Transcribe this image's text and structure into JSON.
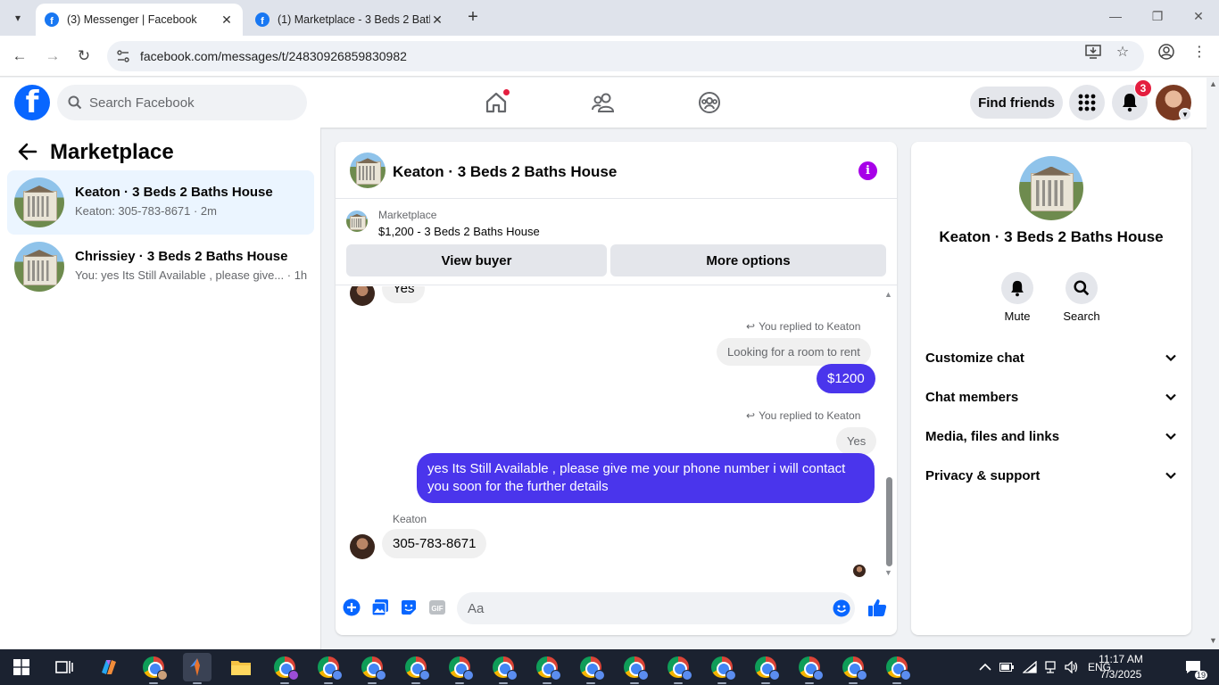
{
  "browser": {
    "tabs": [
      {
        "title": "(3) Messenger | Facebook",
        "active": true
      },
      {
        "title": "(1) Marketplace - 3 Beds 2 Bath",
        "active": false
      }
    ],
    "url": "facebook.com/messages/t/24830926859830982"
  },
  "fb": {
    "search_placeholder": "Search Facebook",
    "find_friends_label": "Find friends",
    "notification_count": "3"
  },
  "sidebar": {
    "title": "Marketplace",
    "conversations": [
      {
        "name": "Keaton · 3 Beds 2 Baths House",
        "preview": "Keaton: 305-783-8671 · 2m"
      },
      {
        "name": "Chrissiey · 3 Beds 2 Baths House",
        "preview": "You: yes Its Still Available , please give... · 1h"
      }
    ]
  },
  "chat": {
    "title": "Keaton · 3 Beds 2 Baths House",
    "listing_source": "Marketplace",
    "listing_title": "$1,200 - 3 Beds 2 Baths House",
    "view_buyer_label": "View buyer",
    "more_options_label": "More options",
    "messages": {
      "in_yes": "Yes",
      "replied_label_1": "You replied to Keaton",
      "reply_quote_1": "Looking for a room to rent",
      "out_price": "$1200",
      "replied_label_2": "You replied to Keaton",
      "reply_quote_2": "Yes",
      "out_long": "yes Its Still Available , please give me your phone number i will contact you soon for the further details",
      "sender": "Keaton",
      "in_phone": "305-783-8671"
    },
    "composer_placeholder": "Aa"
  },
  "info_panel": {
    "name": "Keaton · 3 Beds 2 Baths House",
    "mute_label": "Mute",
    "search_label": "Search",
    "rows": [
      "Customize chat",
      "Chat members",
      "Media, files and links",
      "Privacy & support"
    ]
  },
  "taskbar": {
    "language": "ENG",
    "time": "11:17 AM",
    "date": "7/3/2025",
    "notifications": "19"
  },
  "colors": {
    "fb_blue": "#0866ff",
    "outgoing_bubble": "#4a35ec",
    "info_purple": "#a700e8",
    "badge_red": "#e41e3f"
  }
}
